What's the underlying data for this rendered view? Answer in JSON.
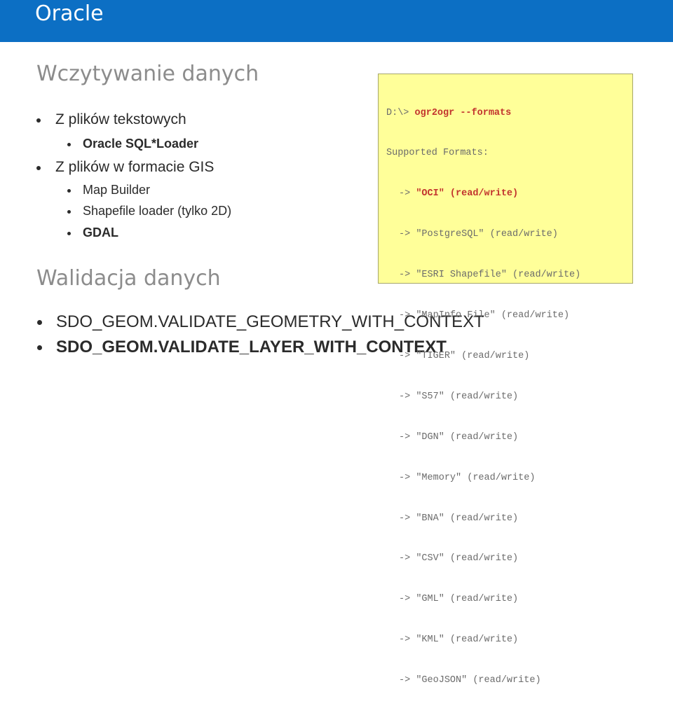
{
  "header": {
    "title": "Oracle"
  },
  "loading": {
    "heading": "Wczytywanie danych",
    "items": [
      {
        "text": "Z plików tekstowych",
        "children": [
          "Oracle SQL*Loader"
        ]
      },
      {
        "text": "Z plików w formacie GIS",
        "children": [
          "Map Builder",
          "Shapefile loader (tylko 2D)",
          "GDAL"
        ]
      }
    ]
  },
  "validation": {
    "heading": "Walidacja danych",
    "items": [
      "SDO_GEOM.VALIDATE_GEOMETRY_WITH_CONTEXT",
      "SDO_GEOM.VALIDATE_LAYER_WITH_CONTEXT"
    ]
  },
  "console": {
    "prompt": "D:\\> ",
    "command": "ogr2ogr --formats",
    "header": "Supported Formats:",
    "arrow": "-> ",
    "formats": [
      "\"OCI\" (read/write)",
      "\"PostgreSQL\" (read/write)",
      "\"ESRI Shapefile\" (read/write)",
      "\"MapInfo File\" (read/write)",
      "\"TIGER\" (read/write)",
      "\"S57\" (read/write)",
      "\"DGN\" (read/write)",
      "\"Memory\" (read/write)",
      "\"BNA\" (read/write)",
      "\"CSV\" (read/write)",
      "\"GML\" (read/write)",
      "\"KML\" (read/write)",
      "\"GeoJSON\" (read/write)"
    ],
    "colors": {
      "background": "#ffff99",
      "highlight": "#c2332e",
      "text": "#6b6b6b"
    }
  }
}
